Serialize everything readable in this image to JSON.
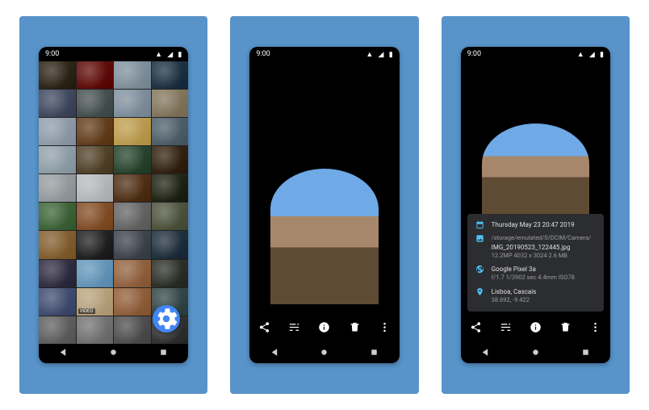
{
  "status": {
    "time": "9:00"
  },
  "grid": {
    "cells": [
      "#3a3224",
      "#6b1a17",
      "#8a9aa6",
      "#2b3e4f",
      "#4c556a",
      "#535c5c",
      "#8a9aa7",
      "#8d8168",
      "#9aa6b4",
      "#6f4b2a",
      "#c7a65b",
      "#5a6b75",
      "#9aa9b2",
      "#5e4e36",
      "#35513b",
      "#3f2f1e",
      "#9fa6a9",
      "#bfc3c5",
      "#5c3d24",
      "#2d3121",
      "#4a6f44",
      "#8e5a34",
      "#707070",
      "#5a5f4a",
      "#8e6a3b",
      "#2e2e2e",
      "#4a5159",
      "#2d3c4a",
      "#3d3a4e",
      "#6fa0c3",
      "#9c6d4a",
      "#3a3d36",
      "#4c587c",
      "#c2ac87",
      "#9b6a46",
      "#405354",
      "#6b6b6b",
      "#7d7d7d",
      "#5a5a5a",
      "#3e3e3e"
    ],
    "video_badge": "VIDEO"
  },
  "viewer": {
    "actions": [
      "share",
      "tune",
      "info",
      "delete",
      "more"
    ]
  },
  "info": {
    "date": "Thursday May 23 20:47 2019",
    "folder": "/storage/emulated/0/DCIM/Camera/",
    "filename": "IMG_20190523_122445.jpg",
    "image_line": "12.2MP   4032 x 3024   2.6 MB",
    "camera": "Google Pixel 3a",
    "camera_line": "f/1.7   1/3902 sec   4.4mm   ISO78",
    "place": "Lisboa, Cascais",
    "coords": "38.692, -9.422"
  }
}
